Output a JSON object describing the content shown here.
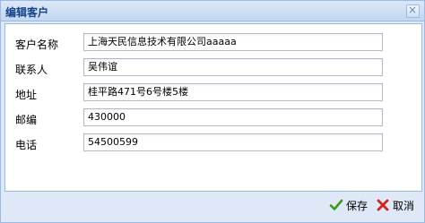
{
  "window": {
    "title": "编辑客户",
    "close_icon": "×"
  },
  "form": {
    "fields": [
      {
        "label": "客户名称",
        "value": "上海天民信息技术有限公司aaaaa"
      },
      {
        "label": "联系人",
        "value": "吴伟谊"
      },
      {
        "label": "地址",
        "value": "桂平路471号6号楼5楼"
      },
      {
        "label": "邮编",
        "value": "430000"
      },
      {
        "label": "电话",
        "value": "54500599"
      }
    ]
  },
  "buttons": {
    "save_label": "保存",
    "cancel_label": "取消"
  },
  "colors": {
    "title": "#15428b",
    "border": "#99bbe8",
    "save_icon": "#3a9a1a",
    "cancel_icon": "#d42020"
  }
}
